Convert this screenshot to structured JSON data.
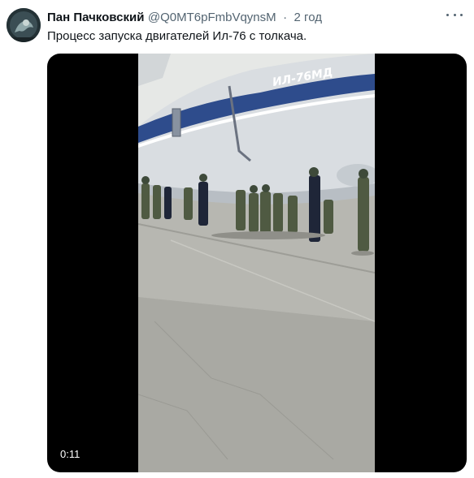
{
  "tweet": {
    "author_name": "Пан Пачковский",
    "handle": "@Q0MT6pFmbVqynsM",
    "separator": "·",
    "time": "2 год",
    "text": "Процесс запуска двигателей Ил-76 с толкача.",
    "more_icon": "more-horizontal-icon"
  },
  "media": {
    "duration": "0:11",
    "aircraft_marking": "ИЛ-76МД"
  }
}
